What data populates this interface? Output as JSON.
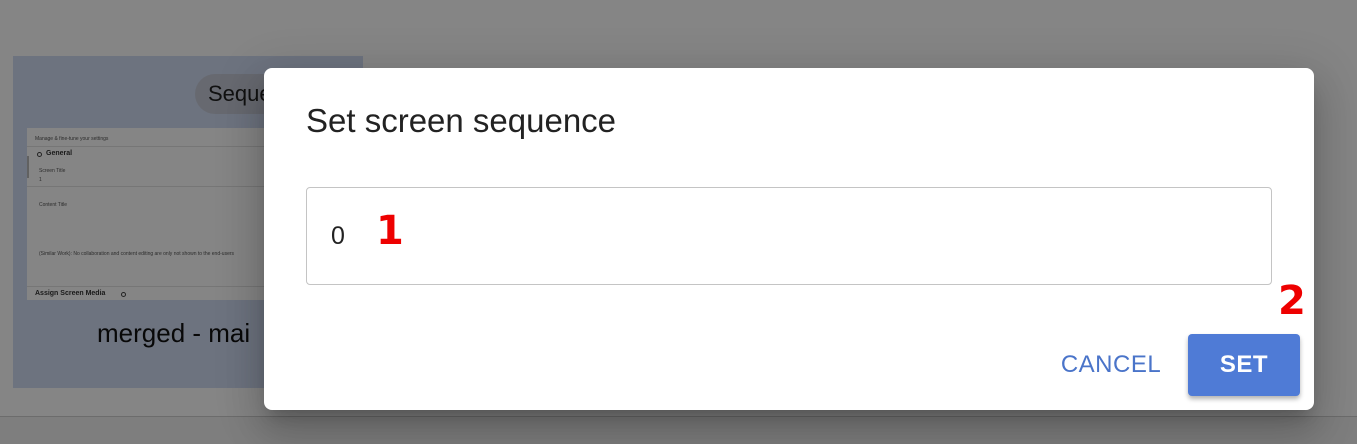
{
  "background": {
    "card": {
      "chip_label": "Seque",
      "title": "merged - mai",
      "thumbnail": {
        "caption": "Manage & fine-tune your settings",
        "section_general": "General",
        "field_label": "Screen Title",
        "field_value": "1",
        "field_label_2": "Content Title",
        "note": "(Similar Work): No collaboration and content editing are only not shown to the end-users",
        "section_media": "Assign Screen Media"
      }
    }
  },
  "dialog": {
    "title": "Set screen sequence",
    "sequence_input": {
      "value": "0"
    },
    "cancel_label": "CANCEL",
    "set_label": "SET"
  },
  "annotations": {
    "marker_1": "1",
    "marker_2": "2"
  },
  "colors": {
    "primary": "#4f7bd6",
    "cancel_text": "#4a74c9",
    "marker": "#ee0000",
    "card_bg": "#d2dcf4"
  }
}
